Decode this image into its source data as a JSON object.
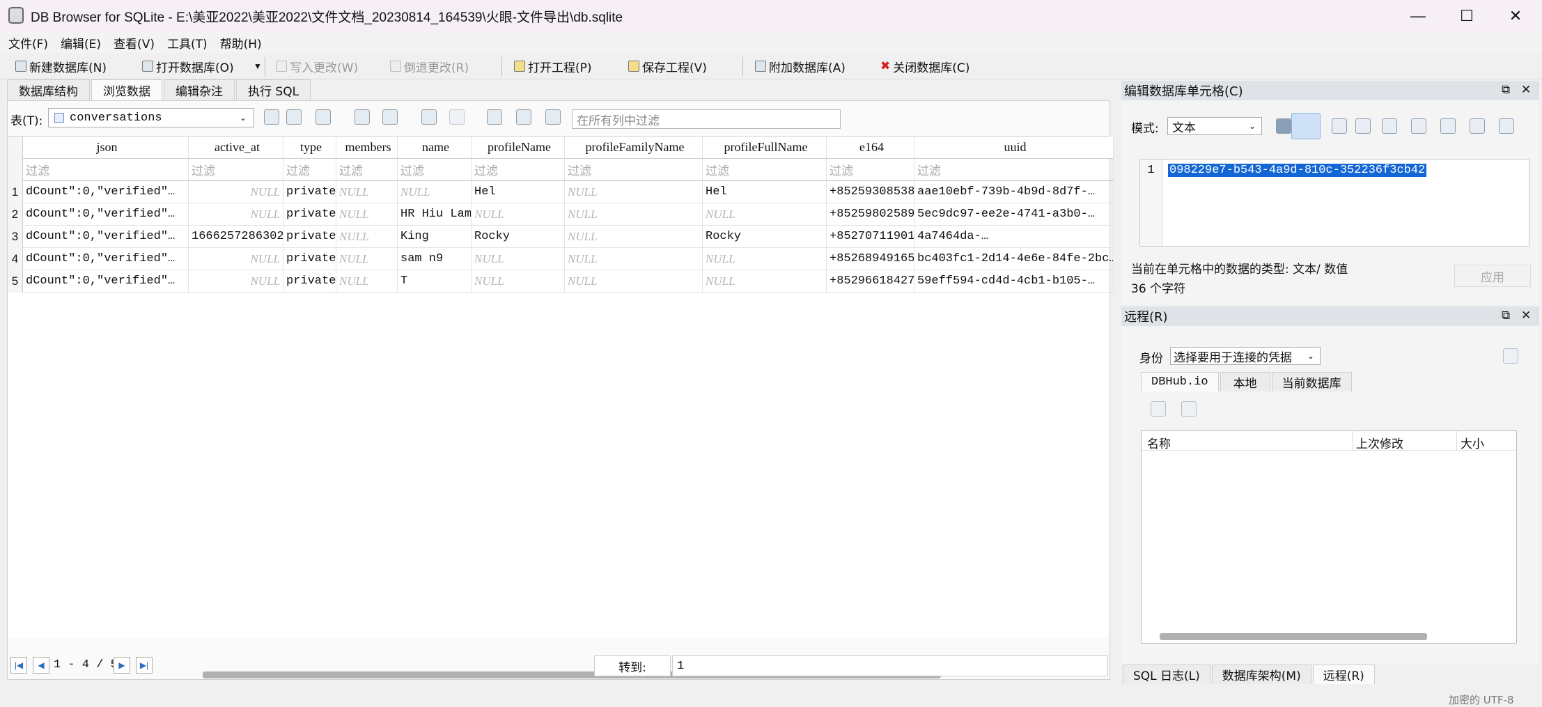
{
  "window": {
    "title": "DB Browser for SQLite - E:\\美亚2022\\美亚2022\\文件文档_20230814_164539\\火眼-文件导出\\db.sqlite",
    "minimize": "—",
    "maximize": "☐",
    "close": "✕"
  },
  "menu": [
    "文件(F)",
    "编辑(E)",
    "查看(V)",
    "工具(T)",
    "帮助(H)"
  ],
  "toolbar": {
    "new_db": "新建数据库(N)",
    "open_db": "打开数据库(O)",
    "write_changes": "写入更改(W)",
    "revert_changes": "倒退更改(R)",
    "open_project": "打开工程(P)",
    "save_project": "保存工程(V)",
    "attach_db": "附加数据库(A)",
    "close_db": "关闭数据库(C)"
  },
  "main_tabs": [
    "数据库结构",
    "浏览数据",
    "编辑杂注",
    "执行 SQL"
  ],
  "browse": {
    "table_label": "表(T):",
    "table_value": "conversations",
    "filter_all_placeholder": "在所有列中过滤",
    "filter_placeholder": "过滤",
    "columns": [
      "json",
      "active_at",
      "type",
      "members",
      "name",
      "profileName",
      "profileFamilyName",
      "profileFullName",
      "e164",
      "uuid"
    ],
    "rows": [
      {
        "num": "1",
        "json": "dCount\":0,\"verified\"…",
        "active_at": "NULL",
        "type": "private",
        "members": "NULL",
        "name": "NULL",
        "profileName": "Hel",
        "profileFamilyName": "NULL",
        "profileFullName": "Hel",
        "e164": "+85259308538",
        "uuid": "aae10ebf-739b-4b9d-8d7f-…"
      },
      {
        "num": "2",
        "json": "dCount\":0,\"verified\"…",
        "active_at": "NULL",
        "type": "private",
        "members": "NULL",
        "name": "HR Hiu Lam",
        "profileName": "NULL",
        "profileFamilyName": "NULL",
        "profileFullName": "NULL",
        "e164": "+85259802589",
        "uuid": "5ec9dc97-ee2e-4741-a3b0-…"
      },
      {
        "num": "3",
        "json": "dCount\":0,\"verified\"…",
        "active_at": "1666257286302",
        "type": "private",
        "members": "NULL",
        "name": "King",
        "profileName": "Rocky",
        "profileFamilyName": "NULL",
        "profileFullName": "Rocky",
        "e164": "+85270711901",
        "uuid": "4a7464da-…"
      },
      {
        "num": "4",
        "json": "dCount\":0,\"verified\"…",
        "active_at": "NULL",
        "type": "private",
        "members": "NULL",
        "name": "sam n9",
        "profileName": "NULL",
        "profileFamilyName": "NULL",
        "profileFullName": "NULL",
        "e164": "+85268949165",
        "uuid": "bc403fc1-2d14-4e6e-84fe-2bc…"
      },
      {
        "num": "5",
        "json": "dCount\":0,\"verified\"…",
        "active_at": "NULL",
        "type": "private",
        "members": "NULL",
        "name": "T",
        "profileName": "NULL",
        "profileFamilyName": "NULL",
        "profileFullName": "NULL",
        "e164": "+85296618427",
        "uuid": "59eff594-cd4d-4cb1-b105-…"
      }
    ],
    "pager_text": "1 - 4 / 5",
    "goto_label": "转到:",
    "goto_value": "1"
  },
  "edit_cell": {
    "title": "编辑数据库单元格(C)",
    "mode_label": "模式:",
    "mode_value": "文本",
    "line_number": "1",
    "value": "098229e7-b543-4a9d-810c-352236f3cb42",
    "type_info": "当前在单元格中的数据的类型: 文本/ 数值",
    "size_info": "36 个字符",
    "apply_button": "应用"
  },
  "remote": {
    "title": "远程(R)",
    "identity_label": "身份",
    "identity_value": "选择要用于连接的凭据",
    "tabs": [
      "DBHub.io",
      "本地",
      "当前数据库"
    ],
    "columns": [
      "名称",
      "上次修改",
      "大小"
    ]
  },
  "bottom_tabs": [
    "SQL 日志(L)",
    "数据库架构(M)",
    "远程(R)"
  ],
  "status": {
    "encoding": "加密的 UTF-8"
  }
}
